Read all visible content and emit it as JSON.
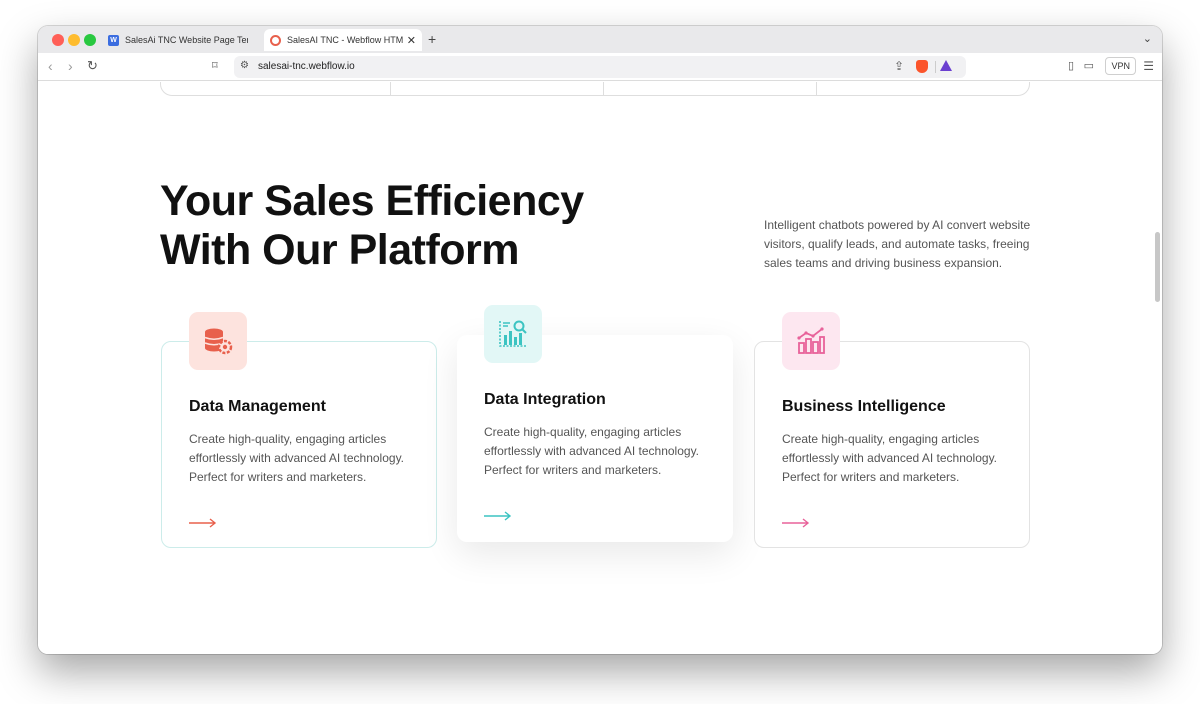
{
  "browser": {
    "tabs": [
      {
        "title": "SalesAi TNC Website Page Templ"
      },
      {
        "title": "SalesAI TNC - Webflow HTML"
      }
    ],
    "new_tab_label": "+",
    "url": "salesai-tnc.webflow.io",
    "vpn_label": "VPN"
  },
  "section": {
    "headline_line1_part1": "Your Sales ",
    "headline_highlight": "Efficiency",
    "headline_line2": "With Our Platform",
    "intro": "Intelligent chatbots powered by AI convert website visitors, qualify leads, and automate tasks, freeing sales teams and driving business expansion."
  },
  "cards": [
    {
      "title": "Data Management",
      "desc": "Create high-quality, engaging articles effortlessly with advanced AI technology. Perfect for writers and marketers.",
      "icon": "database-gear-icon",
      "accent": "#e8604c",
      "icon_bg": "#fde3de"
    },
    {
      "title": "Data Integration",
      "desc": "Create high-quality, engaging articles effortlessly with advanced AI technology. Perfect for writers and marketers.",
      "icon": "analytics-chart-icon",
      "accent": "#3cc4c2",
      "icon_bg": "#e2f7f6"
    },
    {
      "title": "Business Intelligence",
      "desc": "Create high-quality, engaging articles effortlessly with advanced AI technology. Perfect for writers and marketers.",
      "icon": "growth-chart-icon",
      "accent": "#e8629a",
      "icon_bg": "#fde7f0"
    }
  ]
}
